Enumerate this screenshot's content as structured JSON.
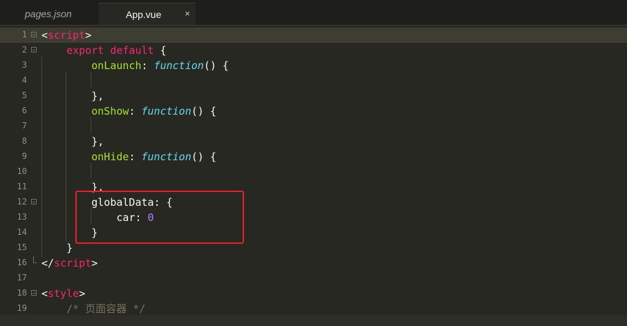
{
  "tabs": [
    {
      "label": "pages.json",
      "active": false
    },
    {
      "label": "App.vue",
      "active": true,
      "close_icon": "×"
    }
  ],
  "lines": [
    {
      "n": "1",
      "fold": "open"
    },
    {
      "n": "2",
      "fold": "open"
    },
    {
      "n": "3"
    },
    {
      "n": "4"
    },
    {
      "n": "5"
    },
    {
      "n": "6"
    },
    {
      "n": "7"
    },
    {
      "n": "8"
    },
    {
      "n": "9"
    },
    {
      "n": "10"
    },
    {
      "n": "11"
    },
    {
      "n": "12",
      "fold": "open"
    },
    {
      "n": "13"
    },
    {
      "n": "14"
    },
    {
      "n": "15"
    },
    {
      "n": "16",
      "fold": "end"
    },
    {
      "n": "17"
    },
    {
      "n": "18",
      "fold": "open"
    },
    {
      "n": "19"
    }
  ],
  "code": {
    "l1_open": "<",
    "l1_tag": "script",
    "l1_close": ">",
    "l2_kw1": "export",
    "l2_kw2": "default",
    "l2_brace": "{",
    "l3_name": "onLaunch",
    "l3_colon": ": ",
    "l3_func": "function",
    "l3_rest": "() {",
    "l5": "},",
    "l6_name": "onShow",
    "l6_colon": ": ",
    "l6_func": "function",
    "l6_rest": "() {",
    "l8": "},",
    "l9_name": "onHide",
    "l9_colon": ": ",
    "l9_func": "function",
    "l9_rest": "() {",
    "l11": "},",
    "l12_name": "globalData",
    "l12_rest": ": {",
    "l13_name": "car",
    "l13_colon": ": ",
    "l13_num": "0",
    "l14": "}",
    "l15": "}",
    "l16_open": "</",
    "l16_tag": "script",
    "l16_close": ">",
    "l18_open": "<",
    "l18_tag": "style",
    "l18_close": ">",
    "l19": "/* 页面容器 */"
  },
  "colors": {
    "background": "#272822",
    "tag": "#f92672",
    "function_name": "#a6e22e",
    "storage": "#66d9ef",
    "number": "#ae81ff",
    "comment": "#75715e",
    "annotation_box": "#e8212b"
  }
}
